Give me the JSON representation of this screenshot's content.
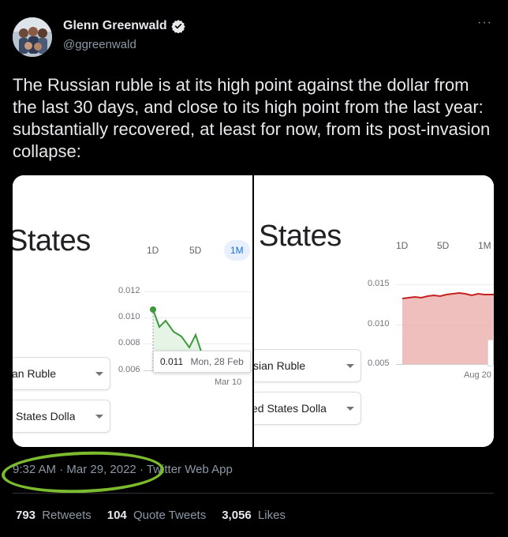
{
  "author": {
    "display_name": "Glenn Greenwald",
    "handle": "@ggreenwald",
    "verified_icon": "verified-badge-icon",
    "avatar_icon": "group-photo-avatar"
  },
  "more_label": "···",
  "tweet_text": "The Russian ruble is at its high point against the dollar from the last 30 days, and close to its high point from the last year: substantially recovered, at least for now, from its post-invasion collapse:",
  "left_panel": {
    "title": "States",
    "tabs": [
      "1D",
      "5D",
      "1M"
    ],
    "active_tab": "1M",
    "y_ticks": [
      "0.012",
      "0.010",
      "0.008",
      "0.006"
    ],
    "x_tick": "Mar 10",
    "dropdown_1": "an Ruble",
    "dropdown_2": "l States Dolla",
    "tooltip_value": "0.011",
    "tooltip_date": "Mon, 28 Feb",
    "line_color": "#3c9a3c"
  },
  "right_panel": {
    "title": "States",
    "tabs": [
      "1D",
      "5D",
      "1M"
    ],
    "y_ticks": [
      "0.015",
      "0.010",
      "0.005"
    ],
    "x_tick": "Aug 20",
    "dropdown_1": "sian Ruble",
    "dropdown_2": "ed States Dolla",
    "line_color": "#c5221f"
  },
  "meta": {
    "time": "9:32 AM",
    "date": "Mar 29, 2022",
    "separator": "·",
    "source": "Twitter Web App"
  },
  "stats": {
    "retweets_count": "793",
    "retweets_label": "Retweets",
    "quotes_count": "104",
    "quotes_label": "Quote Tweets",
    "likes_count": "3,056",
    "likes_label": "Likes"
  },
  "annotation_color": "#7cbb2e"
}
